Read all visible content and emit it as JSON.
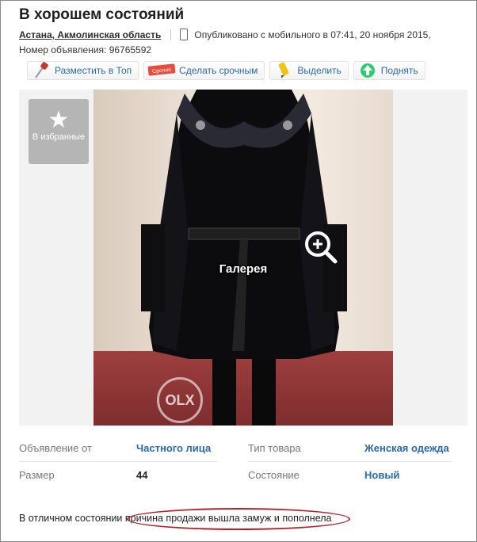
{
  "ad": {
    "title": "В хорошем состояний",
    "location": "Астана, Акмолинская область",
    "published": "Опубликовано с мобильного в 07:41, 20 ноября 2015,",
    "ad_number": "Номер объявления: 96765592"
  },
  "toolbar": {
    "top_label": "Разместить в Топ",
    "urgent_label": "Сделать срочным",
    "urgent_badge": "Срочно",
    "highlight_label": "Выделить",
    "raise_label": "Поднять"
  },
  "gallery": {
    "favorite_label": "В избранные",
    "gallery_label": "Галерея",
    "watermark": "OLX"
  },
  "properties": {
    "offer_from_label": "Объявление от",
    "offer_from_value": "Частного лица",
    "product_type_label": "Тип товара",
    "product_type_value": "Женская одежда",
    "size_label": "Размер",
    "size_value": "44",
    "condition_label": "Состояние",
    "condition_value": "Новый"
  },
  "description": {
    "text_part1": "В отличном состоянии",
    "text_part2": " причина продажи вышла замуж и пополнела"
  },
  "colors": {
    "link": "#2a6aa8",
    "highlight_oval": "#b3202b"
  }
}
